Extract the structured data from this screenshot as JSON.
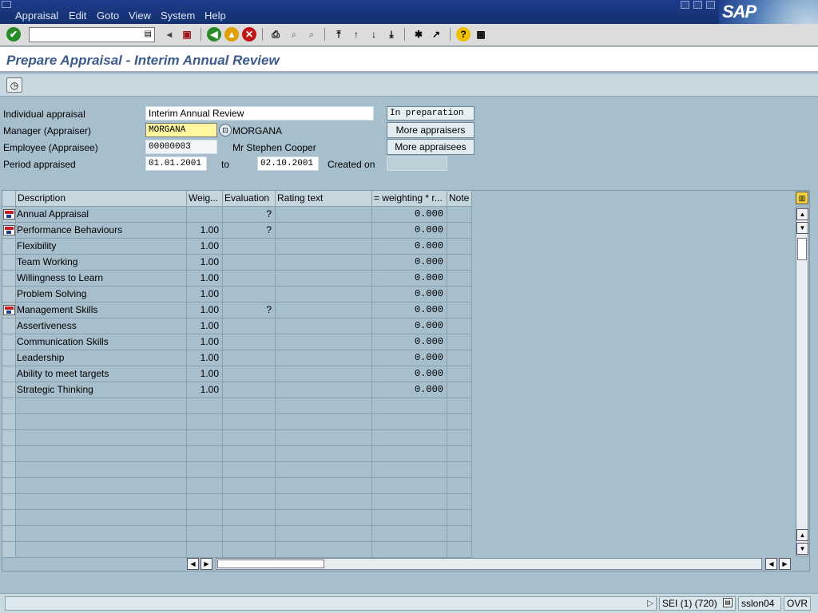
{
  "menubar": {
    "items": [
      "Appraisal",
      "Edit",
      "Goto",
      "View",
      "System",
      "Help"
    ],
    "brand": "SAP"
  },
  "toolbar": {
    "command_value": ""
  },
  "title": "Prepare Appraisal - Interim Annual Review",
  "form": {
    "individual_appraisal_label": "Individual appraisal",
    "individual_appraisal_value": "Interim Annual Review",
    "status": "In preparation",
    "manager_label": "Manager (Appraiser)",
    "manager_value": "MORGANA",
    "manager_name": "MORGANA",
    "more_appraisers": "More appraisers",
    "employee_label": "Employee (Appraisee)",
    "employee_value": "00000003",
    "employee_name": "Mr Stephen Cooper",
    "more_appraisees": "More appraisees",
    "period_label": "Period appraised",
    "period_from": "01.01.2001",
    "to_label": "to",
    "period_to": "02.10.2001",
    "created_on_label": "Created on",
    "created_on_value": ""
  },
  "table": {
    "columns": [
      "Description",
      "Weig...",
      "Evaluation",
      "Rating text",
      "= weighting  * r...",
      "Note"
    ],
    "rows": [
      {
        "description": "Annual Appraisal",
        "weight": "",
        "evaluation": "?",
        "rating": "",
        "score": "0.000",
        "icon": true
      },
      {
        "description": "Performance Behaviours",
        "weight": "1.00",
        "evaluation": "?",
        "rating": "",
        "score": "0.000",
        "icon": true
      },
      {
        "description": "Flexibility",
        "weight": "1.00",
        "evaluation": "",
        "rating": "",
        "score": "0.000",
        "icon": false
      },
      {
        "description": "Team Working",
        "weight": "1.00",
        "evaluation": "",
        "rating": "",
        "score": "0.000",
        "icon": false
      },
      {
        "description": "Willingness to Learn",
        "weight": "1.00",
        "evaluation": "",
        "rating": "",
        "score": "0.000",
        "icon": false
      },
      {
        "description": "Problem Solving",
        "weight": "1.00",
        "evaluation": "",
        "rating": "",
        "score": "0.000",
        "icon": false
      },
      {
        "description": "Management Skills",
        "weight": "1.00",
        "evaluation": "?",
        "rating": "",
        "score": "0.000",
        "icon": true
      },
      {
        "description": "Assertiveness",
        "weight": "1.00",
        "evaluation": "",
        "rating": "",
        "score": "0.000",
        "icon": false
      },
      {
        "description": "Communication Skills",
        "weight": "1.00",
        "evaluation": "",
        "rating": "",
        "score": "0.000",
        "icon": false
      },
      {
        "description": "Leadership",
        "weight": "1.00",
        "evaluation": "",
        "rating": "",
        "score": "0.000",
        "icon": false
      },
      {
        "description": "Ability to meet targets",
        "weight": "1.00",
        "evaluation": "",
        "rating": "",
        "score": "0.000",
        "icon": false
      },
      {
        "description": "Strategic Thinking",
        "weight": "1.00",
        "evaluation": "",
        "rating": "",
        "score": "0.000",
        "icon": false
      }
    ],
    "empty_rows": 10
  },
  "statusbar": {
    "system": "SEI (1) (720)",
    "server": "sslon04",
    "mode": "OVR"
  }
}
